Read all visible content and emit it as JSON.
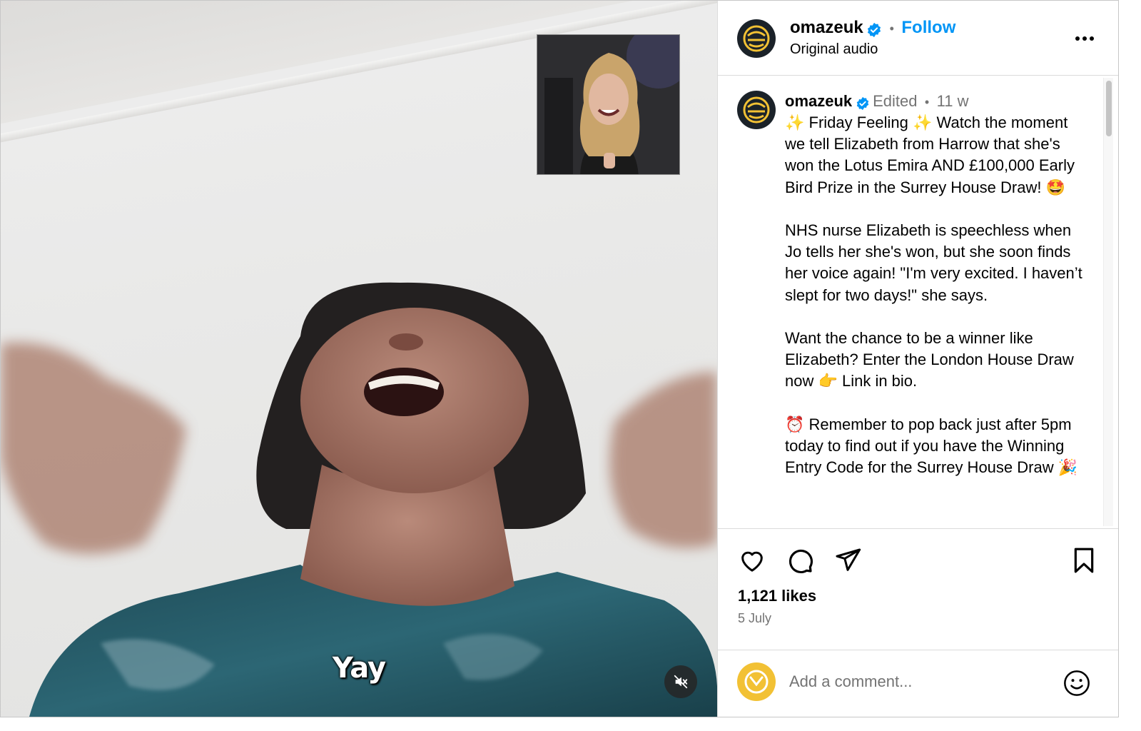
{
  "header": {
    "username": "omazeuk",
    "follow_label": "Follow",
    "audio_label": "Original audio"
  },
  "post": {
    "username": "omazeuk",
    "edited_label": "Edited",
    "age": "11 w",
    "caption": "✨ Friday Feeling ✨ Watch the moment we tell Elizabeth from Harrow that she's won the Lotus Emira AND £100,000 Early Bird Prize in the Surrey House Draw! 🤩\n\nNHS nurse Elizabeth is speechless when Jo tells her she's won, but she soon finds her voice again! \"I'm very excited. I haven’t slept for two days!\" she says.\n\nWant the chance to be a winner like Elizabeth? Enter the London House Draw now 👉 Link in bio.\n\n⏰ Remember to pop back just after 5pm today to find out if you have the Winning Entry Code for the Surrey House Draw 🎉"
  },
  "video": {
    "subtitle": "Yay"
  },
  "stats": {
    "likes": "1,121 likes",
    "date": "5 July"
  },
  "comment_box": {
    "placeholder": "Add a comment..."
  },
  "colors": {
    "accent_blue": "#0095f6",
    "brand_dark": "#1b2229",
    "brand_gold": "#f2c134"
  }
}
